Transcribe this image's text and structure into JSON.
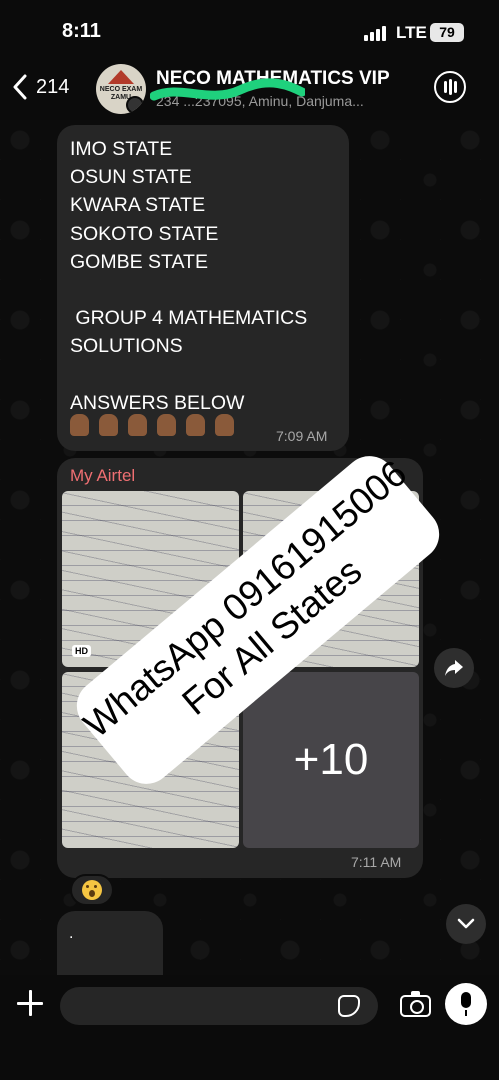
{
  "status_bar": {
    "time": "8:11",
    "network": "LTE",
    "battery": "79"
  },
  "header": {
    "back_count": "214",
    "title": "NECO MATHEMATICS VIP",
    "subtitle": "234 ...237095, Aminu, Danjuma...",
    "avatar_text": "NECO EXAM ZAMU"
  },
  "messages": [
    {
      "text": "IMO STATE\nOSUN STATE\nKWARA STATE\nSOKOTO STATE\nGOMBE STATE\n\n GROUP 4 MATHEMATICS\nSOLUTIONS\n\nANSWERS BELOW",
      "emoji_count": 6,
      "time": "7:09 AM"
    },
    {
      "sender": "My Airtel",
      "hd_label": "HD",
      "more_count": "+10",
      "time": "7:11 AM"
    },
    {
      "text": "."
    }
  ],
  "reaction": "surprised-face",
  "watermark": {
    "line1": "WhatsApp  09161915006",
    "line2": "For All States"
  },
  "composer": {
    "placeholder": ""
  },
  "colors": {
    "sender": "#ef6f72",
    "bubble": "#262626",
    "background": "#0b0b0b"
  }
}
